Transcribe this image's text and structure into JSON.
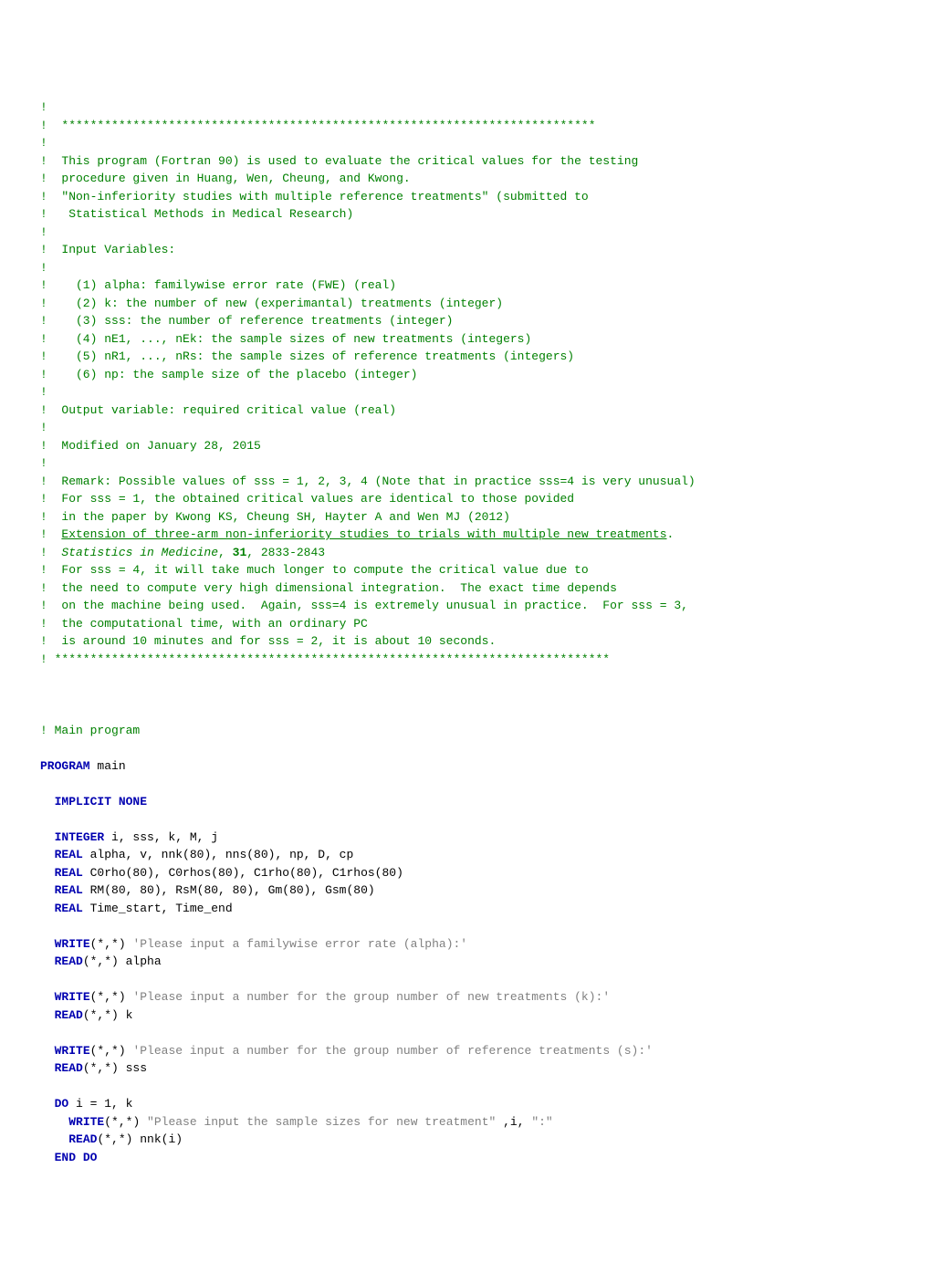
{
  "lines": [
    {
      "spans": [
        {
          "cls": "c-green",
          "t": "!"
        }
      ]
    },
    {
      "spans": [
        {
          "cls": "c-green",
          "t": "!  ***************************************************************************"
        }
      ]
    },
    {
      "spans": [
        {
          "cls": "c-green",
          "t": "!"
        }
      ]
    },
    {
      "spans": [
        {
          "cls": "c-green",
          "t": "!  This program (Fortran 90) is used to evaluate the critical values for the testing"
        }
      ]
    },
    {
      "spans": [
        {
          "cls": "c-green",
          "t": "!  procedure given in Huang, Wen, Cheung, and Kwong."
        }
      ]
    },
    {
      "spans": [
        {
          "cls": "c-green",
          "t": "!  \"Non-inferiority studies with multiple reference treatments\" (submitted to"
        }
      ]
    },
    {
      "spans": [
        {
          "cls": "c-green",
          "t": "!   Statistical Methods in Medical Research)"
        }
      ]
    },
    {
      "spans": [
        {
          "cls": "c-green",
          "t": "!"
        }
      ]
    },
    {
      "spans": [
        {
          "cls": "c-green",
          "t": "!  Input Variables:"
        }
      ]
    },
    {
      "spans": [
        {
          "cls": "c-green",
          "t": "!"
        }
      ]
    },
    {
      "spans": [
        {
          "cls": "c-green",
          "t": "!    (1) alpha: familywise error rate (FWE) (real)"
        }
      ]
    },
    {
      "spans": [
        {
          "cls": "c-green",
          "t": "!    (2) k: the number of new (experimantal) treatments (integer)"
        }
      ]
    },
    {
      "spans": [
        {
          "cls": "c-green",
          "t": "!    (3) sss: the number of reference treatments (integer)"
        }
      ]
    },
    {
      "spans": [
        {
          "cls": "c-green",
          "t": "!    (4) nE1, ..., nEk: the sample sizes of new treatments (integers)"
        }
      ]
    },
    {
      "spans": [
        {
          "cls": "c-green",
          "t": "!    (5) nR1, ..., nRs: the sample sizes of reference treatments (integers)"
        }
      ]
    },
    {
      "spans": [
        {
          "cls": "c-green",
          "t": "!    (6) np: the sample size of the placebo (integer)"
        }
      ]
    },
    {
      "spans": [
        {
          "cls": "c-green",
          "t": "!"
        }
      ]
    },
    {
      "spans": [
        {
          "cls": "c-green",
          "t": "!  Output variable: required critical value (real)"
        }
      ]
    },
    {
      "spans": [
        {
          "cls": "c-green",
          "t": "!"
        }
      ]
    },
    {
      "spans": [
        {
          "cls": "c-green",
          "t": "!  Modified on January 28, 2015"
        }
      ]
    },
    {
      "spans": [
        {
          "cls": "c-green",
          "t": "!"
        }
      ]
    },
    {
      "spans": [
        {
          "cls": "c-green",
          "t": "!  Remark: Possible values of sss = 1, 2, 3, 4 (Note that in practice sss=4 is very unusual)"
        }
      ]
    },
    {
      "spans": [
        {
          "cls": "c-green",
          "t": "!  For sss = 1, the obtained critical values are identical to those povided"
        }
      ]
    },
    {
      "spans": [
        {
          "cls": "c-green",
          "t": "!  in the paper by Kwong KS, Cheung SH, Hayter A and Wen MJ (2012)"
        }
      ]
    },
    {
      "spans": [
        {
          "cls": "c-green",
          "t": "!  "
        },
        {
          "cls": "c-green c-underline",
          "t": "Extension of three-arm non-inferiority studies to trials with multiple new treatments"
        },
        {
          "cls": "c-green",
          "t": "."
        }
      ]
    },
    {
      "spans": [
        {
          "cls": "c-green",
          "t": "!  "
        },
        {
          "cls": "c-green c-italic",
          "t": "Statistics in Medicine"
        },
        {
          "cls": "c-green",
          "t": ", "
        },
        {
          "cls": "c-green c-bold",
          "t": "31"
        },
        {
          "cls": "c-green",
          "t": ", 2833-2843"
        }
      ]
    },
    {
      "spans": [
        {
          "cls": "c-green",
          "t": "!  For sss = 4, it will take much longer to compute the critical value due to"
        }
      ]
    },
    {
      "spans": [
        {
          "cls": "c-green",
          "t": "!  the need to compute very high dimensional integration.  The exact time depends"
        }
      ]
    },
    {
      "spans": [
        {
          "cls": "c-green",
          "t": "!  on the machine being used.  Again, sss=4 is extremely unusual in practice.  For sss = 3,"
        }
      ]
    },
    {
      "spans": [
        {
          "cls": "c-green",
          "t": "!  the computational time, with an ordinary PC"
        }
      ]
    },
    {
      "spans": [
        {
          "cls": "c-green",
          "t": "!  is around 10 minutes and for sss = 2, it is about 10 seconds."
        }
      ]
    },
    {
      "spans": [
        {
          "cls": "c-green",
          "t": "! ******************************************************************************"
        }
      ]
    },
    {
      "spans": [
        {
          "cls": "c-black",
          "t": ""
        }
      ]
    },
    {
      "spans": [
        {
          "cls": "c-black",
          "t": ""
        }
      ]
    },
    {
      "spans": [
        {
          "cls": "c-black",
          "t": ""
        }
      ]
    },
    {
      "spans": [
        {
          "cls": "c-green",
          "t": "! Main program"
        }
      ]
    },
    {
      "spans": [
        {
          "cls": "c-black",
          "t": ""
        }
      ]
    },
    {
      "spans": [
        {
          "cls": "c-blue-bold",
          "t": "PROGRAM"
        },
        {
          "cls": "c-black",
          "t": " main"
        }
      ]
    },
    {
      "spans": [
        {
          "cls": "c-black",
          "t": ""
        }
      ]
    },
    {
      "spans": [
        {
          "cls": "c-black",
          "t": "  "
        },
        {
          "cls": "c-blue-bold",
          "t": "IMPLICIT NONE"
        }
      ]
    },
    {
      "spans": [
        {
          "cls": "c-black",
          "t": ""
        }
      ]
    },
    {
      "spans": [
        {
          "cls": "c-black",
          "t": "  "
        },
        {
          "cls": "c-blue-bold",
          "t": "INTEGER"
        },
        {
          "cls": "c-black",
          "t": " i, sss, k, M, j"
        }
      ]
    },
    {
      "spans": [
        {
          "cls": "c-black",
          "t": "  "
        },
        {
          "cls": "c-blue-bold",
          "t": "REAL"
        },
        {
          "cls": "c-black",
          "t": " alpha, v, nnk(80), nns(80), np, D, cp"
        }
      ]
    },
    {
      "spans": [
        {
          "cls": "c-black",
          "t": "  "
        },
        {
          "cls": "c-blue-bold",
          "t": "REAL"
        },
        {
          "cls": "c-black",
          "t": " C0rho(80), C0rhos(80), C1rho(80), C1rhos(80)"
        }
      ]
    },
    {
      "spans": [
        {
          "cls": "c-black",
          "t": "  "
        },
        {
          "cls": "c-blue-bold",
          "t": "REAL"
        },
        {
          "cls": "c-black",
          "t": " RM(80, 80), RsM(80, 80), Gm(80), Gsm(80)"
        }
      ]
    },
    {
      "spans": [
        {
          "cls": "c-black",
          "t": "  "
        },
        {
          "cls": "c-blue-bold",
          "t": "REAL"
        },
        {
          "cls": "c-black",
          "t": " Time_start, Time_end"
        }
      ]
    },
    {
      "spans": [
        {
          "cls": "c-black",
          "t": ""
        }
      ]
    },
    {
      "spans": [
        {
          "cls": "c-black",
          "t": "  "
        },
        {
          "cls": "c-blue-bold",
          "t": "WRITE"
        },
        {
          "cls": "c-black",
          "t": "(*,*) "
        },
        {
          "cls": "c-string",
          "t": "'Please input a familywise error rate (alpha):'"
        }
      ]
    },
    {
      "spans": [
        {
          "cls": "c-black",
          "t": "  "
        },
        {
          "cls": "c-blue-bold",
          "t": "READ"
        },
        {
          "cls": "c-black",
          "t": "(*,*) alpha"
        }
      ]
    },
    {
      "spans": [
        {
          "cls": "c-black",
          "t": ""
        }
      ]
    },
    {
      "spans": [
        {
          "cls": "c-black",
          "t": "  "
        },
        {
          "cls": "c-blue-bold",
          "t": "WRITE"
        },
        {
          "cls": "c-black",
          "t": "(*,*) "
        },
        {
          "cls": "c-string",
          "t": "'Please input a number for the group number of new treatments (k):'"
        }
      ]
    },
    {
      "spans": [
        {
          "cls": "c-black",
          "t": "  "
        },
        {
          "cls": "c-blue-bold",
          "t": "READ"
        },
        {
          "cls": "c-black",
          "t": "(*,*) k"
        }
      ]
    },
    {
      "spans": [
        {
          "cls": "c-black",
          "t": ""
        }
      ]
    },
    {
      "spans": [
        {
          "cls": "c-black",
          "t": "  "
        },
        {
          "cls": "c-blue-bold",
          "t": "WRITE"
        },
        {
          "cls": "c-black",
          "t": "(*,*) "
        },
        {
          "cls": "c-string",
          "t": "'Please input a number for the group number of reference treatments (s):'"
        }
      ]
    },
    {
      "spans": [
        {
          "cls": "c-black",
          "t": "  "
        },
        {
          "cls": "c-blue-bold",
          "t": "READ"
        },
        {
          "cls": "c-black",
          "t": "(*,*) sss"
        }
      ]
    },
    {
      "spans": [
        {
          "cls": "c-black",
          "t": ""
        }
      ]
    },
    {
      "spans": [
        {
          "cls": "c-black",
          "t": "  "
        },
        {
          "cls": "c-blue-bold",
          "t": "DO"
        },
        {
          "cls": "c-black",
          "t": " i = 1, k"
        }
      ]
    },
    {
      "spans": [
        {
          "cls": "c-black",
          "t": "    "
        },
        {
          "cls": "c-blue-bold",
          "t": "WRITE"
        },
        {
          "cls": "c-black",
          "t": "(*,*) "
        },
        {
          "cls": "c-string",
          "t": "\"Please input the sample sizes for new treatment\""
        },
        {
          "cls": "c-black",
          "t": " ,i, "
        },
        {
          "cls": "c-string",
          "t": "\":\""
        }
      ]
    },
    {
      "spans": [
        {
          "cls": "c-black",
          "t": "    "
        },
        {
          "cls": "c-blue-bold",
          "t": "READ"
        },
        {
          "cls": "c-black",
          "t": "(*,*) nnk(i)"
        }
      ]
    },
    {
      "spans": [
        {
          "cls": "c-black",
          "t": "  "
        },
        {
          "cls": "c-blue-bold",
          "t": "END DO"
        }
      ]
    }
  ]
}
